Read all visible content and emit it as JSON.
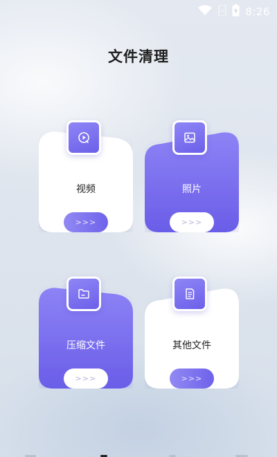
{
  "status_bar": {
    "time": "8:26",
    "icons": [
      "wifi-icon",
      "sim-icon",
      "battery-icon"
    ]
  },
  "header": {
    "title": "文件清理"
  },
  "cards": [
    {
      "id": "video",
      "label": "视频",
      "button": ">>>",
      "style": "white",
      "icon": "video-icon"
    },
    {
      "id": "photo",
      "label": "照片",
      "button": ">>>",
      "style": "purple",
      "icon": "image-icon"
    },
    {
      "id": "archive",
      "label": "压缩文件",
      "button": ">>>",
      "style": "purple",
      "icon": "folder-icon"
    },
    {
      "id": "other",
      "label": "其他文件",
      "button": ">>>",
      "style": "white",
      "icon": "document-icon"
    }
  ],
  "colors": {
    "accent": "#7266ec",
    "accent_light": "#978ef5",
    "card_white": "#ffffff",
    "title": "#1e1e1e"
  }
}
